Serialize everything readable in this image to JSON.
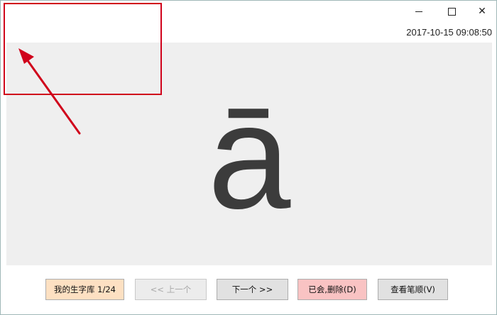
{
  "window": {
    "controls": {
      "minimize_glyph": "",
      "maximize_glyph": "",
      "close_glyph": "✕"
    },
    "timestamp": "2017-10-15 09:08:50"
  },
  "display": {
    "character": "ā"
  },
  "buttons": {
    "library_label": "我的生字库 1/24",
    "prev_label": "<< 上一个",
    "next_label": "下一个 >>",
    "known_label": "已会,删除(D)",
    "strokes_label": "查看笔顺(V)"
  },
  "colors": {
    "annotation": "#d0021b",
    "display_bg": "#efefef",
    "library_bg": "#fde0c2",
    "known_bg": "#f9c3c3"
  }
}
